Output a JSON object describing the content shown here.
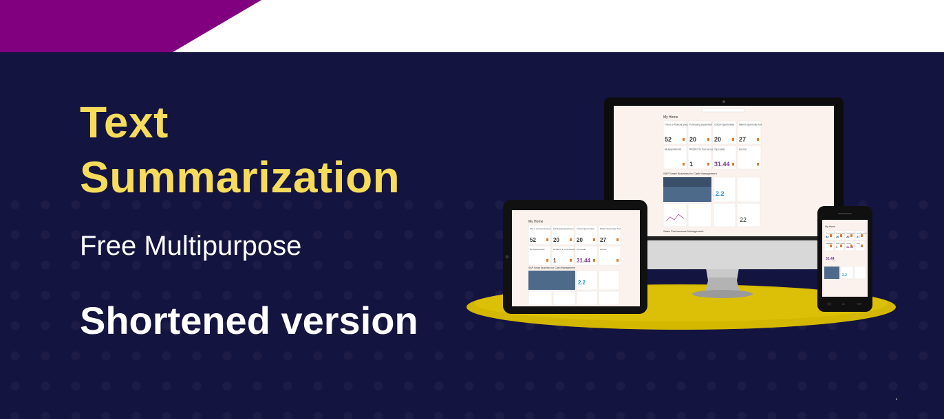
{
  "banner": {
    "title_line1": "Text",
    "title_line2": "Summarization",
    "subtitle": "Free Multipurpose",
    "tagline": "Shortened version"
  },
  "colors": {
    "accent_purple": "#800080",
    "background_navy": "#141440",
    "title_yellow": "#f7dc5c",
    "platform_yellow": "#d4b800"
  },
  "mockup": {
    "home_title": "My Home",
    "section_cash": "SAP Smart Business for Cash Management",
    "section_sales": "Sales Performance Management",
    "tiles": [
      {
        "label": "This is a Financial group",
        "value": "52"
      },
      {
        "label": "Purchasing Department",
        "value": "20"
      },
      {
        "label": "Critical Opportunities",
        "value": "20"
      },
      {
        "label": "Market Opportunity Tool",
        "value": "27"
      }
    ],
    "tile_row2": [
      {
        "label": "My Appointments",
        "value": ""
      },
      {
        "label": "RFQM Of In Your Account",
        "value": "1"
      },
      {
        "label": "Top Leader",
        "value": "31.44"
      },
      {
        "label": "Accrual",
        "value": ""
      }
    ],
    "cash_position_value": "2.2",
    "liquidity_value": "22",
    "phone_value": "31.44"
  }
}
